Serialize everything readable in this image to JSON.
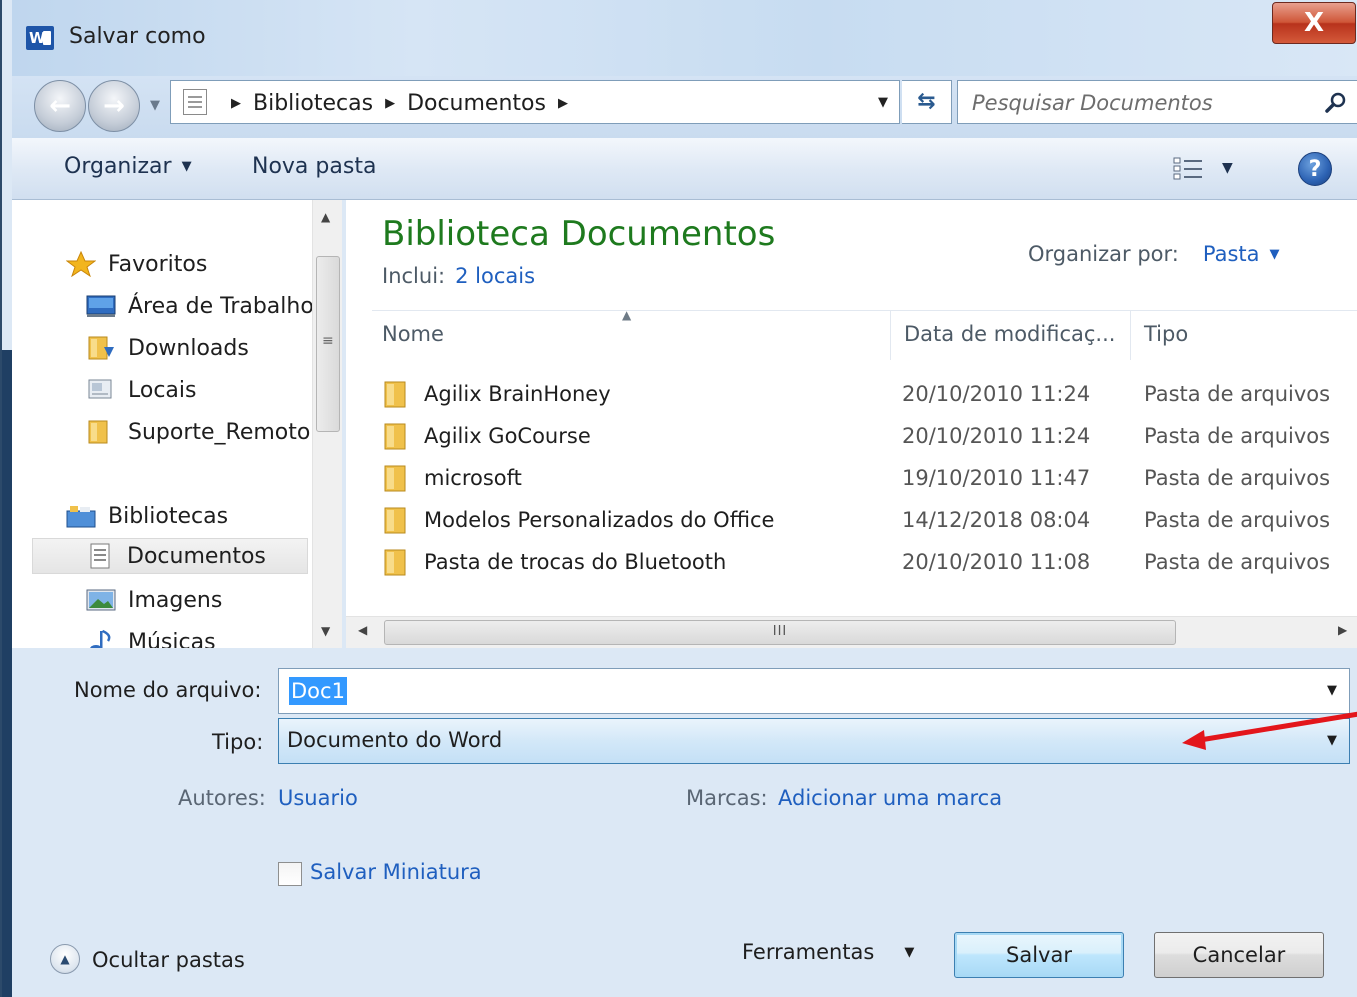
{
  "window": {
    "title": "Salvar como",
    "app_icon_letter": "W",
    "close_glyph": "X"
  },
  "address_bar": {
    "crumbs": [
      "Bibliotecas",
      "Documentos"
    ],
    "search_placeholder": "Pesquisar Documentos"
  },
  "toolbar": {
    "organize_label": "Organizar",
    "new_folder_label": "Nova pasta",
    "help_glyph": "?"
  },
  "nav_pane": {
    "favorites_label": "Favoritos",
    "items": [
      {
        "label": "Área de Trabalho",
        "icon": "desktop-icon"
      },
      {
        "label": "Downloads",
        "icon": "downloads-folder-icon"
      },
      {
        "label": "Locais",
        "icon": "recent-places-icon"
      },
      {
        "label": "Suporte_Remoto",
        "icon": "folder-icon"
      }
    ],
    "libraries_label": "Bibliotecas",
    "library_items": [
      {
        "label": "Documentos",
        "icon": "documents-icon",
        "selected": true
      },
      {
        "label": "Imagens",
        "icon": "pictures-icon"
      },
      {
        "label": "Músicas",
        "icon": "music-icon"
      }
    ]
  },
  "content": {
    "library_title": "Biblioteca Documentos",
    "includes_label": "Inclui:",
    "includes_link": "2 locais",
    "arrange_label": "Organizar por:",
    "arrange_value": "Pasta",
    "columns": [
      "Nome",
      "Data de modificaç...",
      "Tipo"
    ],
    "rows": [
      {
        "name": "Agilix BrainHoney",
        "date": "20/10/2010 11:24",
        "type": "Pasta de arquivos"
      },
      {
        "name": "Agilix GoCourse",
        "date": "20/10/2010 11:24",
        "type": "Pasta de arquivos"
      },
      {
        "name": "microsoft",
        "date": "19/10/2010 11:47",
        "type": "Pasta de arquivos"
      },
      {
        "name": "Modelos Personalizados do Office",
        "date": "14/12/2018 08:04",
        "type": "Pasta de arquivos"
      },
      {
        "name": "Pasta de trocas do Bluetooth",
        "date": "20/10/2010 11:08",
        "type": "Pasta de arquivos"
      }
    ],
    "hscroll_grip": "III"
  },
  "form": {
    "filename_label": "Nome do arquivo:",
    "filename_value": "Doc1",
    "type_label": "Tipo:",
    "type_value": "Documento do Word",
    "authors_label": "Autores:",
    "authors_value": "Usuario",
    "tags_label": "Marcas:",
    "tags_value": "Adicionar uma marca",
    "thumbnail_label": "Salvar Miniatura",
    "thumbnail_checked": false
  },
  "footer": {
    "hide_folders_label": "Ocultar pastas",
    "tools_label": "Ferramentas",
    "save_label": "Salvar",
    "cancel_label": "Cancelar"
  },
  "colors": {
    "library_title": "#1e7a1e",
    "link": "#1f5fbf",
    "annotation_arrow": "#e3161b",
    "selection": "#3399ff"
  }
}
